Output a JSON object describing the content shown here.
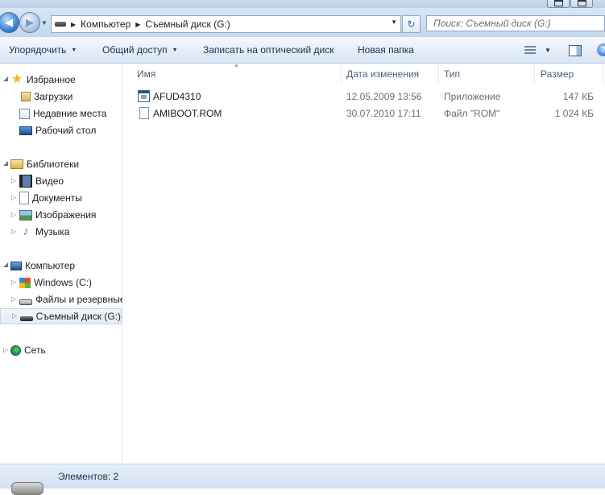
{
  "address": {
    "crumbs": [
      "Компьютер",
      "Съемный диск (G:)"
    ]
  },
  "search": {
    "placeholder": "Поиск: Съемный диск (G:)"
  },
  "toolbar": {
    "organize": "Упорядочить",
    "share": "Общий доступ",
    "burn": "Записать на оптический диск",
    "new_folder": "Новая папка"
  },
  "nav": {
    "favorites": {
      "label": "Избранное",
      "items": [
        "Загрузки",
        "Недавние места",
        "Рабочий стол"
      ]
    },
    "libraries": {
      "label": "Библиотеки",
      "items": [
        "Видео",
        "Документы",
        "Изображения",
        "Музыка"
      ]
    },
    "computer": {
      "label": "Компьютер",
      "items": [
        "Windows (C:)",
        "Файлы и резервные",
        "Съемный диск (G:)"
      ],
      "selected": "Съемный диск (G:)"
    },
    "network": {
      "label": "Сеть"
    }
  },
  "columns": {
    "name": "Имя",
    "date": "Дата изменения",
    "type": "Тип",
    "size": "Размер"
  },
  "files": [
    {
      "name": "AFUD4310",
      "date": "12.05.2009 13:56",
      "type": "Приложение",
      "size": "147 КБ",
      "icon": "exe-icon"
    },
    {
      "name": "AMIBOOT.ROM",
      "date": "30.07.2010 17:11",
      "type": "Файл \"ROM\"",
      "size": "1 024 КБ",
      "icon": "file-icon"
    }
  ],
  "status": {
    "items": "Элементов: 2"
  }
}
